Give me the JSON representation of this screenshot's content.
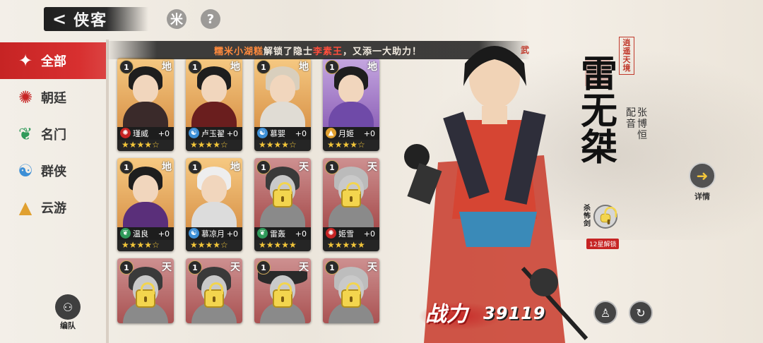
{
  "header": {
    "back_glyph": "<",
    "title": "侠客",
    "help_glyph": "?",
    "filter_glyph": "米"
  },
  "announcement": {
    "player": "糯米小湖糕",
    "text1": "解锁了隐士",
    "hero": "李素王",
    "text2": "，又添一大助力！",
    "tail": "武"
  },
  "sidebar": {
    "items": [
      {
        "label": "全部",
        "icon": "all-icon",
        "active": true
      },
      {
        "label": "朝廷",
        "icon": "court-icon",
        "active": false
      },
      {
        "label": "名门",
        "icon": "sect-icon",
        "active": false
      },
      {
        "label": "群侠",
        "icon": "heroes-icon",
        "active": false
      },
      {
        "label": "云游",
        "icon": "wander-icon",
        "active": false
      }
    ],
    "team_button": "编队"
  },
  "cards": [
    {
      "level": "1",
      "grade": "地",
      "name": "瑾威",
      "plus": "+0",
      "stars": "★★★★☆",
      "style": "gold",
      "locked": false
    },
    {
      "level": "1",
      "grade": "地",
      "name": "卢玉翟",
      "plus": "+0",
      "stars": "★★★★☆",
      "style": "gold",
      "locked": false
    },
    {
      "level": "1",
      "grade": "地",
      "name": "慕婴",
      "plus": "+0",
      "stars": "★★★★☆",
      "style": "gold",
      "locked": false
    },
    {
      "level": "1",
      "grade": "地",
      "name": "月姬",
      "plus": "+0",
      "stars": "★★★★☆",
      "style": "purple",
      "locked": false
    },
    {
      "level": "1",
      "grade": "地",
      "name": "温良",
      "plus": "+0",
      "stars": "★★★★☆",
      "style": "gold",
      "locked": false
    },
    {
      "level": "1",
      "grade": "地",
      "name": "慕凉月",
      "plus": "+0",
      "stars": "★★★★☆",
      "style": "gold",
      "locked": false
    },
    {
      "level": "1",
      "grade": "天",
      "name": "雷轰",
      "plus": "+0",
      "stars": "★★★★★",
      "style": "locked",
      "locked": true
    },
    {
      "level": "1",
      "grade": "天",
      "name": "姬雪",
      "plus": "+0",
      "stars": "★★★★★",
      "style": "locked",
      "locked": true
    },
    {
      "level": "1",
      "grade": "天",
      "name": "",
      "plus": "",
      "stars": "",
      "style": "locked",
      "locked": true
    },
    {
      "level": "1",
      "grade": "天",
      "name": "",
      "plus": "",
      "stars": "",
      "style": "locked",
      "locked": true
    },
    {
      "level": "1",
      "grade": "天",
      "name": "",
      "plus": "",
      "stars": "",
      "style": "locked",
      "locked": true
    },
    {
      "level": "1",
      "grade": "天",
      "name": "",
      "plus": "",
      "stars": "",
      "style": "locked",
      "locked": true
    }
  ],
  "hero": {
    "name": "雷无桀",
    "title": "逍遥天境",
    "voice_label": "配音",
    "voice_actor": "张博恒",
    "skill_name": "杀怖剑",
    "skill_condition": "12星解锁",
    "detail_label": "详情",
    "power_label": "战力",
    "power_value": "39119"
  },
  "colors": {
    "accent_red": "#c62424",
    "star_gold": "#f3c63a",
    "announce_highlight": "#ff8a3d"
  }
}
